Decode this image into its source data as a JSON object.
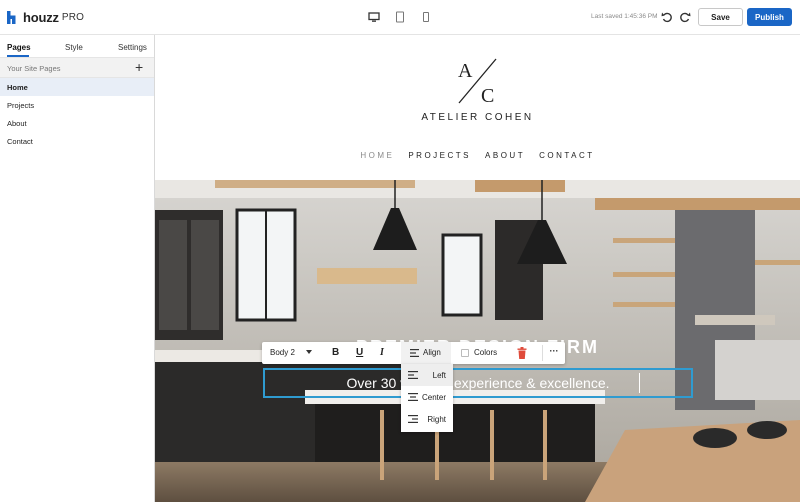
{
  "app": {
    "brand": "houzz",
    "edition": "PRO"
  },
  "toolbar": {
    "devices": [
      "desktop-icon",
      "tablet-icon",
      "mobile-icon"
    ],
    "last_saved": "Last saved 1:45:36 PM",
    "save_label": "Save",
    "publish_label": "Publish"
  },
  "sidebar": {
    "tabs": [
      {
        "label": "Pages",
        "active": true
      },
      {
        "label": "Style",
        "active": false
      },
      {
        "label": "Settings",
        "active": false
      }
    ],
    "section_label": "Your Site Pages",
    "add_icon": "+",
    "pages": [
      {
        "label": "Home",
        "active": true
      },
      {
        "label": "Projects",
        "active": false
      },
      {
        "label": "About",
        "active": false
      },
      {
        "label": "Contact",
        "active": false
      }
    ]
  },
  "site": {
    "logo_text": "A/C",
    "name": "ATELIER COHEN",
    "nav": [
      "HOME",
      "PROJECTS",
      "ABOUT",
      "CONTACT"
    ],
    "hero_heading": "PREMIER DESIGN FIRM",
    "hero_subtext": "Over 30 years of experience & excellence."
  },
  "text_toolbar": {
    "style_value": "Body 2",
    "bold": "B",
    "underline": "U",
    "italic": "I",
    "align_label": "Align",
    "colors_label": "Colors",
    "more_label": "···",
    "align_options": [
      {
        "label": "Left",
        "active": true
      },
      {
        "label": "Center",
        "active": false
      },
      {
        "label": "Right",
        "active": false
      }
    ]
  },
  "colors": {
    "accent": "#1a66c6",
    "selection": "#2f9bd0",
    "delete": "#e04b3b"
  }
}
